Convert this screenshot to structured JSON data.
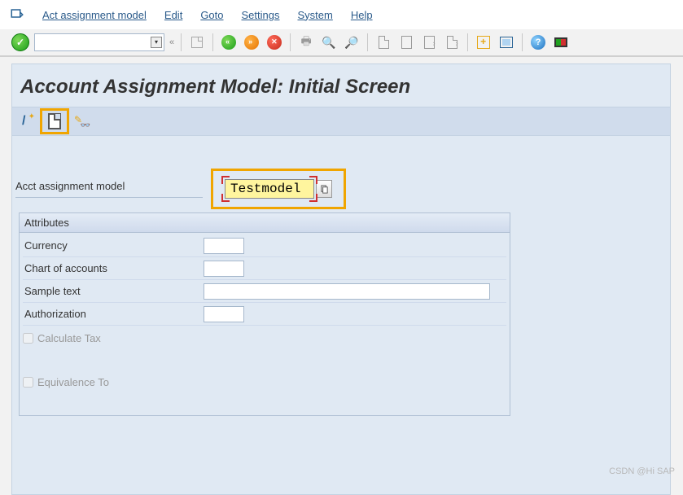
{
  "menu": {
    "items": [
      "Act assignment model",
      "Edit",
      "Goto",
      "Settings",
      "System",
      "Help"
    ]
  },
  "page": {
    "title": "Account Assignment Model: Initial Screen"
  },
  "field": {
    "label": "Acct assignment model",
    "value": "Testmodel"
  },
  "attributes": {
    "title": "Attributes",
    "rows": [
      {
        "label": "Currency",
        "size": "sm"
      },
      {
        "label": "Chart of accounts",
        "size": "sm"
      },
      {
        "label": "Sample text",
        "size": "lg"
      },
      {
        "label": "Authorization",
        "size": "sm"
      }
    ],
    "calc_tax": "Calculate Tax",
    "equivalence": "Equivalence To"
  },
  "watermark": "CSDN @Hi SAP"
}
